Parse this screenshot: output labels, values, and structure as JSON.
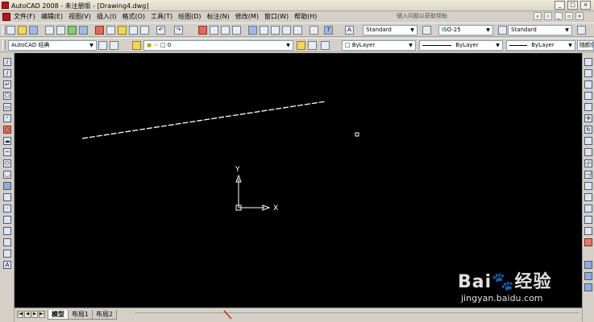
{
  "window": {
    "title": "AutoCAD 2008 - 未注册版 - [Drawing4.dwg]",
    "buttons": [
      "_",
      "□",
      "×"
    ]
  },
  "menu": {
    "items": [
      "文件(F)",
      "编辑(E)",
      "视图(V)",
      "插入(I)",
      "格式(O)",
      "工具(T)",
      "绘图(D)",
      "标注(N)",
      "修改(M)",
      "窗口(W)",
      "帮助(H)"
    ],
    "help_search_placeholder": "键入问题以获取帮助"
  },
  "toolbar": {
    "text_style": "Standard",
    "dim_style": "ISO-25",
    "table_style": "Standard",
    "workspace": "AutoCAD 经典",
    "layer": "0",
    "color": "ByLayer",
    "linetype": "ByLayer",
    "lineweight": "ByLayer",
    "plot_style": "随颜色"
  },
  "canvas": {
    "background": "#000000",
    "ucs": {
      "x_label": "X",
      "y_label": "Y"
    }
  },
  "tabs": [
    "模型",
    "布局1",
    "布局2"
  ],
  "watermark": {
    "logo": "Bai🐾经验",
    "url": "jingyan.baidu.com"
  }
}
